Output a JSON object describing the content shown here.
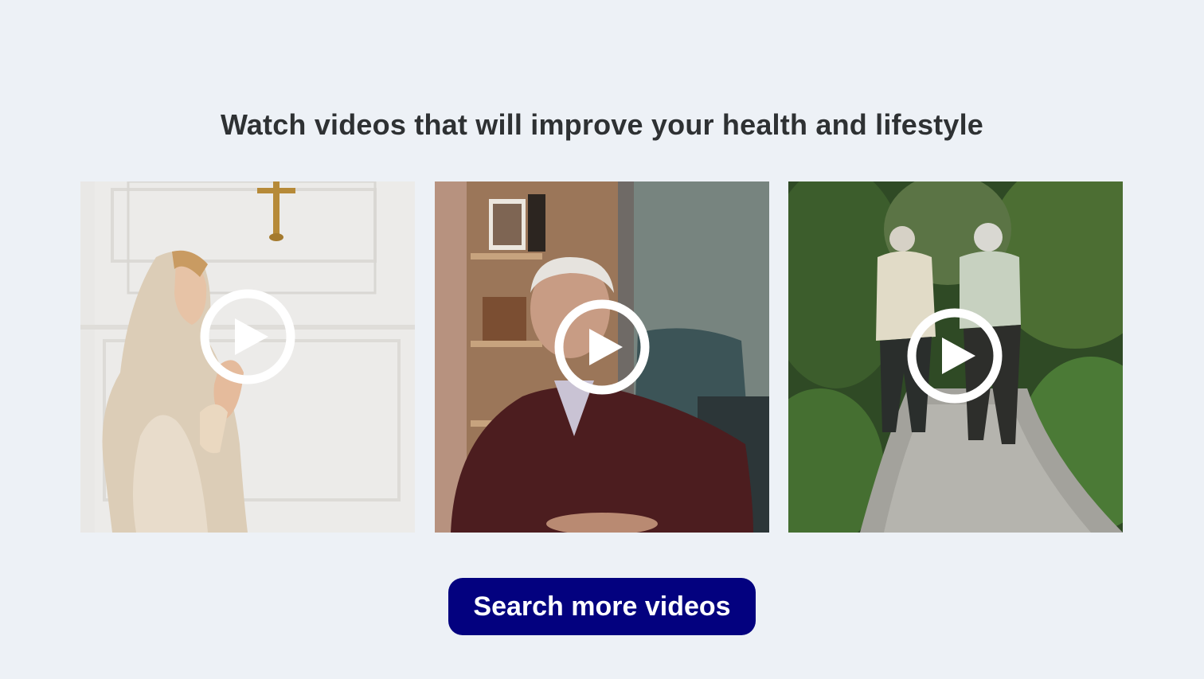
{
  "section": {
    "heading": "Watch videos that will improve your health and lifestyle"
  },
  "videos": [
    {
      "subject": "woman-praying-photo",
      "play_icon": "play-circle-icon"
    },
    {
      "subject": "elderly-man-seated-photo",
      "play_icon": "play-circle-icon"
    },
    {
      "subject": "elderly-couple-walking-photo",
      "play_icon": "play-circle-icon"
    }
  ],
  "cta": {
    "label": "Search more videos"
  },
  "colors": {
    "background": "#edf1f6",
    "heading_text": "#2e3133",
    "button_bg": "#03017f",
    "button_text": "#ffffff",
    "play_icon": "#ffffff"
  }
}
